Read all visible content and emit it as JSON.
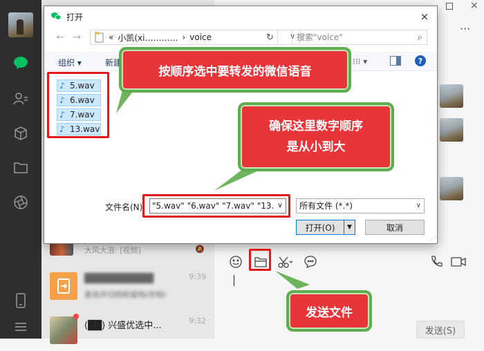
{
  "dialog": {
    "title": "打开",
    "close_icon": "×",
    "nav": {
      "back": "←",
      "forward": "→",
      "up": "↑"
    },
    "address": {
      "prefix": "«",
      "crumb1": "小凯(xi…………",
      "sep": "›",
      "crumb2": "voice"
    },
    "search_placeholder": "搜索\"voice\"",
    "commands": {
      "organize": "组织 ▾",
      "new_folder": "新建",
      "view": "▾"
    },
    "files": [
      "5.wav",
      "6.wav",
      "7.wav",
      "13.wav"
    ],
    "filename_label": "文件名(N):",
    "filename_value": "\"5.wav\" \"6.wav\" \"7.wav\" \"13.wa",
    "filetype": "所有文件 (*.*)",
    "open_button": "打开(O)",
    "cancel_button": "取消"
  },
  "annotations": {
    "select_files": "按顺序选中要转发的微信语音",
    "order_note_line1": "确保这里数字顺序",
    "order_note_line2": "是从小到大",
    "send_file": "发送文件"
  },
  "chat_list": [
    {
      "name": "",
      "msg": "大风大浪: [视频]",
      "time": ""
    },
    {
      "name": "██████████",
      "msg": "查收并归档和留档(存档)",
      "time": "9:39"
    },
    {
      "name": "(██) 兴盛优选中...",
      "msg": "",
      "time": "9:32"
    }
  ],
  "chat": {
    "send_button": "发送(S)",
    "more_icon": "···"
  },
  "colors": {
    "callout_fill": "#e8353a",
    "callout_border": "#5fad4e",
    "highlight_box": "#e0191b",
    "file_selected": "#cce8ff"
  }
}
